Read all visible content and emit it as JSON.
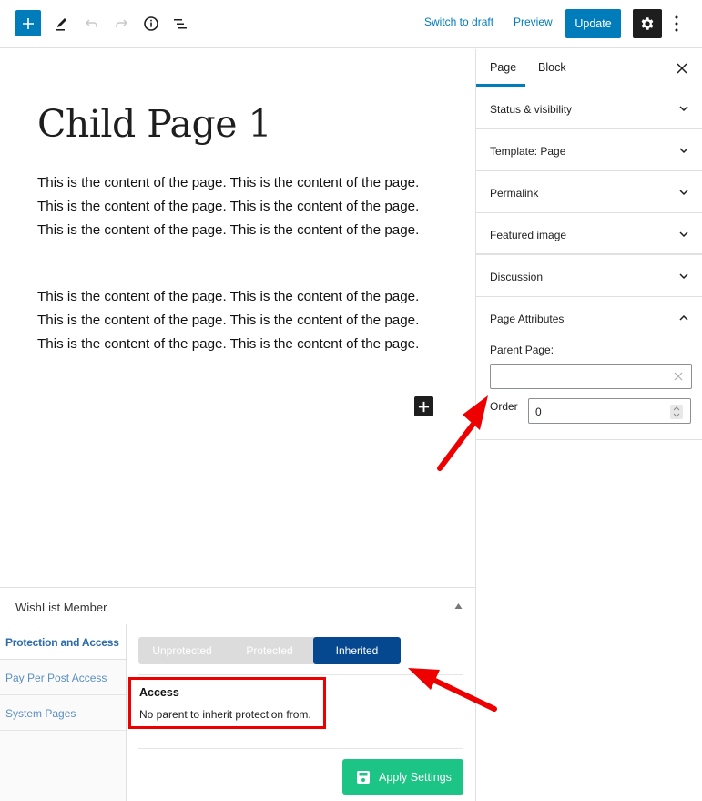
{
  "toolbar": {
    "icons": [
      "plus-icon",
      "pencil-icon",
      "undo-icon",
      "redo-icon",
      "info-icon",
      "list-view-icon",
      "gear-icon",
      "more-vertical-icon"
    ],
    "switch_to_draft": "Switch to draft",
    "preview": "Preview",
    "update": "Update"
  },
  "editor": {
    "title": "Child Page 1",
    "paragraphs": [
      "This is the content of the page. This is the content of the page. This is the content of the page. This is the content of the page. This is the content of the page. This is the content of the page.",
      "This is the content of the page. This is the content of the page. This is the content of the page. This is the content of the page. This is the content of the page. This is the content of the page."
    ]
  },
  "sidebar": {
    "tabs": [
      {
        "label": "Page",
        "active": true
      },
      {
        "label": "Block",
        "active": false
      }
    ],
    "panels": [
      {
        "title": "Status & visibility",
        "expanded": false
      },
      {
        "title": "Template: Page",
        "expanded": false
      },
      {
        "title": "Permalink",
        "expanded": false
      },
      {
        "title": "Featured image",
        "expanded": false
      },
      {
        "title": "Discussion",
        "expanded": false
      }
    ],
    "page_attributes": {
      "title": "Page Attributes",
      "expanded": true,
      "parent_label": "Parent Page:",
      "parent_value": "",
      "order_label": "Order",
      "order_value": "0"
    }
  },
  "wishlist": {
    "title": "WishList Member",
    "nav": [
      {
        "label": "Protection and Access",
        "active": true
      },
      {
        "label": "Pay Per Post Access",
        "active": false
      },
      {
        "label": "System Pages",
        "active": false
      }
    ],
    "protection_options": [
      "Unprotected",
      "Protected",
      "Inherited"
    ],
    "selected_protection": "Inherited",
    "access_title": "Access",
    "access_text": "No parent to inherit protection from.",
    "apply_button": "Apply Settings"
  },
  "colors": {
    "accent": "#007cba",
    "selected_segment": "#05488f",
    "apply_green": "#1cc486",
    "annotation_red": "#ee0000"
  }
}
